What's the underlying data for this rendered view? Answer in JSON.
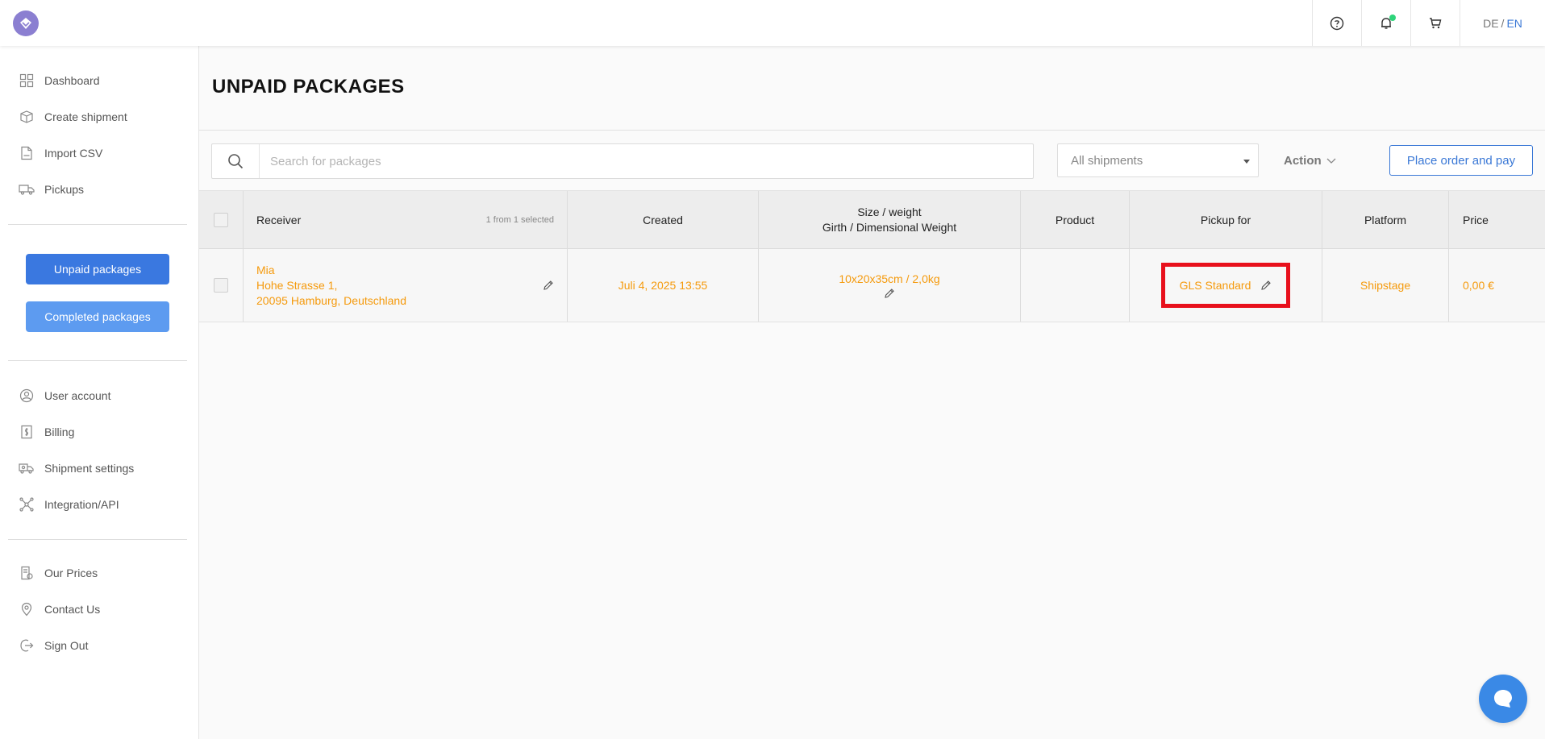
{
  "header": {
    "lang_de": "DE",
    "lang_sep": "/",
    "lang_en": "EN"
  },
  "sidebar": {
    "nav_top": [
      {
        "label": "Dashboard",
        "icon": "dashboard-icon"
      },
      {
        "label": "Create shipment",
        "icon": "box-icon"
      },
      {
        "label": "Import CSV",
        "icon": "csv-file-icon"
      },
      {
        "label": "Pickups",
        "icon": "truck-icon"
      }
    ],
    "unpaid_button": "Unpaid packages",
    "completed_button": "Completed packages",
    "nav_account": [
      {
        "label": "User account",
        "icon": "user-icon"
      },
      {
        "label": "Billing",
        "icon": "billing-icon"
      },
      {
        "label": "Shipment settings",
        "icon": "shipping-settings-icon"
      },
      {
        "label": "Integration/API",
        "icon": "integration-icon"
      }
    ],
    "nav_bottom": [
      {
        "label": "Our Prices",
        "icon": "price-list-icon"
      },
      {
        "label": "Contact Us",
        "icon": "location-pin-icon"
      },
      {
        "label": "Sign Out",
        "icon": "sign-out-icon"
      }
    ]
  },
  "main": {
    "title": "UNPAID PACKAGES",
    "search_placeholder": "Search for packages",
    "filter_selected": "All shipments",
    "action_label": "Action",
    "place_order_label": "Place order and pay"
  },
  "table": {
    "headers": {
      "receiver": "Receiver",
      "selected_count": "1 from 1 selected",
      "created": "Created",
      "size_line1": "Size / weight",
      "size_line2": "Girth / Dimensional Weight",
      "product": "Product",
      "pickup": "Pickup for",
      "platform": "Platform",
      "price": "Price"
    },
    "rows": [
      {
        "receiver_name": "Mia",
        "receiver_street": "Hohe Strasse 1,",
        "receiver_city": "20095 Hamburg, Deutschland",
        "created": "Juli 4, 2025 13:55",
        "size_weight": "10x20x35cm / 2,0kg",
        "product": "",
        "pickup": "GLS Standard",
        "platform": "Shipstage",
        "price": "0,00 €"
      }
    ]
  },
  "colors": {
    "primary": "#3a78e0",
    "accent_orange": "#f59a0c",
    "highlight_red": "#e8101c",
    "notification_green": "#2ed47a"
  }
}
